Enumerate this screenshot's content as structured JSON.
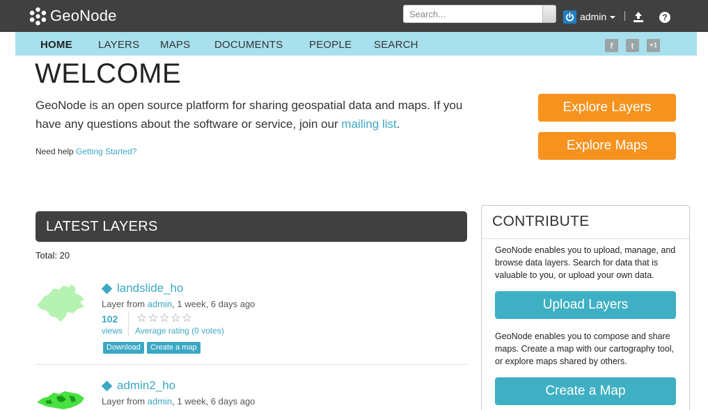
{
  "header": {
    "brand": "GeoNode",
    "search_placeholder": "Search...",
    "user": "admin",
    "help": "?"
  },
  "nav": {
    "items": [
      "HOME",
      "LAYERS",
      "MAPS",
      "DOCUMENTS",
      "PEOPLE",
      "SEARCH"
    ],
    "active": "HOME",
    "social": {
      "facebook": "f",
      "twitter": "t",
      "google": "+1"
    }
  },
  "hero": {
    "title": "WELCOME",
    "intro_before": "GeoNode is an open source platform for sharing geospatial data and maps. If you have any questions about the software or service, join our ",
    "mailing_link": "mailing list",
    "intro_after": ".",
    "help_prefix": "Need help ",
    "help_link": "Getting Started?",
    "explore_layers": "Explore Layers",
    "explore_maps": "Explore Maps"
  },
  "latest": {
    "heading": "LATEST LAYERS",
    "total": "Total: 20",
    "layers": [
      {
        "title": "landslide_ho",
        "meta_prefix": "Layer from ",
        "owner": "admin",
        "meta_suffix": ", 1 week, 6 days ago",
        "views": "102",
        "views_label": "views",
        "rating": "Average rating (0 votes)",
        "download": "Download",
        "create_map": "Create a map"
      },
      {
        "title": "admin2_ho",
        "meta_prefix": "Layer from ",
        "owner": "admin",
        "meta_suffix": ", 1 week, 6 days ago"
      }
    ]
  },
  "contribute": {
    "heading": "CONTRIBUTE",
    "text1": "GeoNode enables you to upload, manage, and browse data layers. Search for data that is valuable to you, or upload your own data.",
    "upload": "Upload Layers",
    "text2": "GeoNode enables you to compose and share maps. Create a map with our cartography tool, or explore maps shared by others.",
    "create": "Create a Map"
  },
  "colors": {
    "topbar": "#404040",
    "navbar": "#a8e0ee",
    "accent": "#3ba8c4",
    "orange": "#f6921e"
  }
}
